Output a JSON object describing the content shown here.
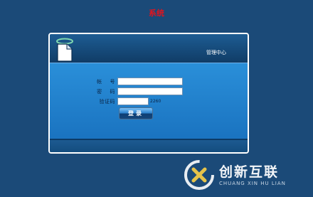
{
  "system_title": "系统",
  "header": {
    "management_center": "管理中心"
  },
  "form": {
    "account_label": "帐    号",
    "password_label": "密    码",
    "captcha_label": "验证码",
    "account_value": "",
    "password_value": "",
    "captcha_value": "",
    "captcha_code": "2260",
    "login_label": "登录"
  },
  "watermark": {
    "text": "创新互联",
    "subtext": "CHUANG XIN HU LIAN"
  },
  "colors": {
    "background": "#1b4a78",
    "title": "#e0141e",
    "panel_body": "#2a8fd9"
  }
}
